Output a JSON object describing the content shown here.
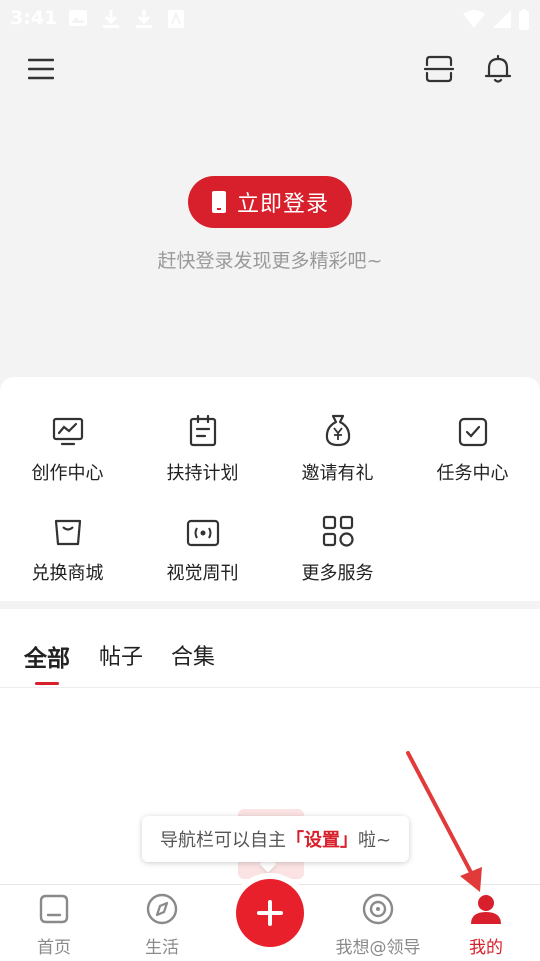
{
  "status_bar": {
    "time": "3:41"
  },
  "login": {
    "button_label": "立即登录",
    "hint": "赶快登录发现更多精彩吧~"
  },
  "services": [
    {
      "label": "创作中心",
      "icon": "chart-monitor-icon"
    },
    {
      "label": "扶持计划",
      "icon": "clipboard-icon"
    },
    {
      "label": "邀请有礼",
      "icon": "money-bag-icon"
    },
    {
      "label": "任务中心",
      "icon": "check-box-icon"
    },
    {
      "label": "兑换商城",
      "icon": "shopping-bag-icon"
    },
    {
      "label": "视觉周刊",
      "icon": "broadcast-icon"
    },
    {
      "label": "更多服务",
      "icon": "grid-apps-icon"
    }
  ],
  "tabs": [
    {
      "label": "全部",
      "active": true
    },
    {
      "label": "帖子",
      "active": false
    },
    {
      "label": "合集",
      "active": false
    }
  ],
  "tooltip": {
    "before": "导航栏可以自主",
    "highlight": "「设置」",
    "after": "啦~"
  },
  "bottom_nav": [
    {
      "label": "首页",
      "icon": "home-icon",
      "active": false
    },
    {
      "label": "生活",
      "icon": "compass-icon",
      "active": false
    },
    {
      "label": "我想@领导",
      "icon": "target-icon",
      "active": false
    },
    {
      "label": "我的",
      "icon": "user-icon",
      "active": true
    }
  ],
  "colors": {
    "accent": "#d7202b",
    "background": "#f3f3f3"
  }
}
